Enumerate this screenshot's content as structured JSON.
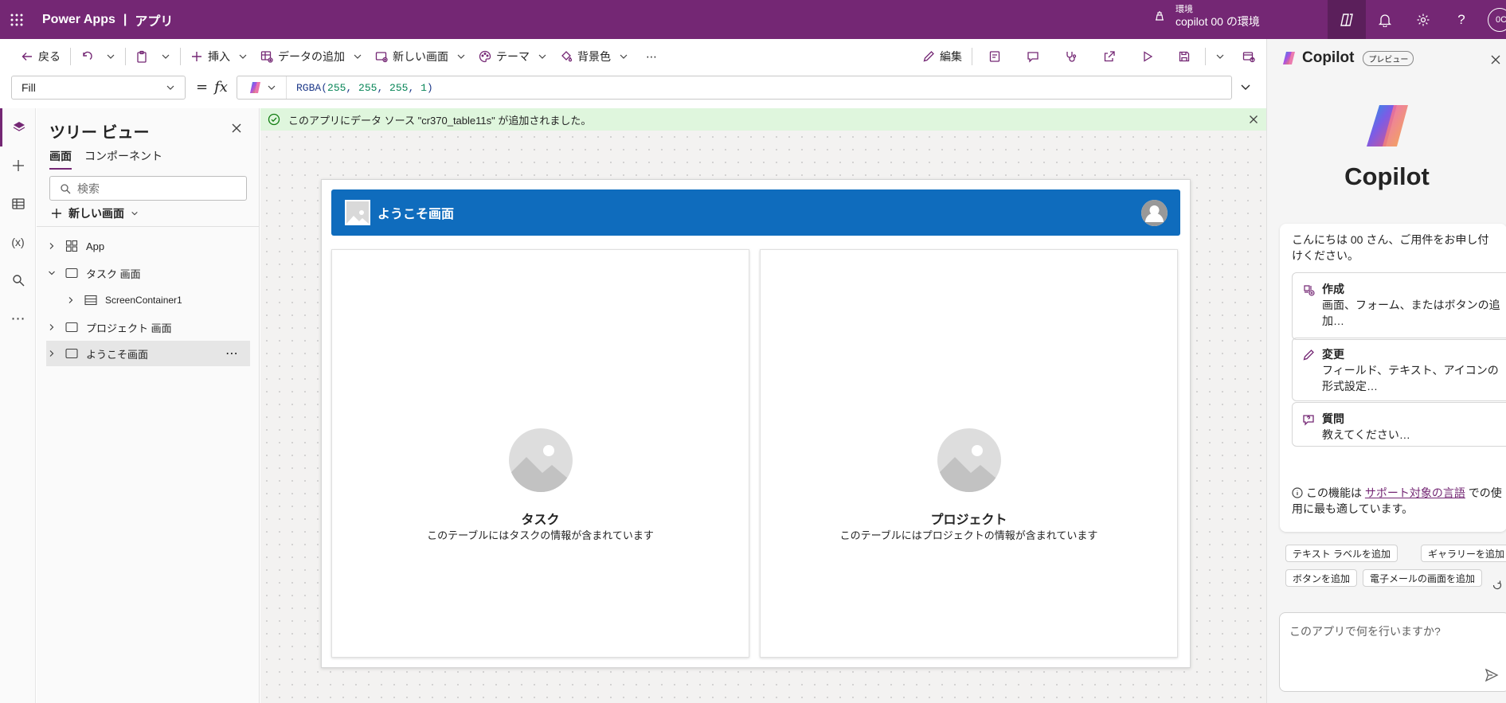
{
  "topbar": {
    "app_name": "Power Apps",
    "separator": "|",
    "section": "アプリ",
    "env_label": "環境",
    "env_name": "copilot 00 の環境",
    "avatar_initials": "0C",
    "bg_color": "#742774"
  },
  "command_bar": {
    "back": "戻る",
    "insert": "挿入",
    "add_data": "データの追加",
    "new_screen": "新しい画面",
    "theme": "テーマ",
    "background": "背景色",
    "more": "⋯",
    "edit": "編集"
  },
  "formula_bar": {
    "property": "Fill",
    "equals": "=",
    "fx": "fx",
    "formula_fn": "RGBA(",
    "formula_args": [
      "255",
      "255",
      "255",
      "1"
    ],
    "formula_close": ")"
  },
  "tree_view": {
    "title": "ツリー ビュー",
    "tabs": [
      "画面",
      "コンポーネント"
    ],
    "search_placeholder": "検索",
    "new_screen": "新しい画面",
    "nodes": [
      {
        "label": "App",
        "icon": "app-icon",
        "expanded": false
      },
      {
        "label": "タスク 画面",
        "icon": "screen-icon",
        "expanded": true
      },
      {
        "label": "ScreenContainer1",
        "icon": "container-icon",
        "expanded": false
      },
      {
        "label": "プロジェクト 画面",
        "icon": "screen-icon",
        "expanded": false
      },
      {
        "label": "ようこそ画面",
        "icon": "screen-icon",
        "expanded": false,
        "selected": true
      }
    ],
    "more": "⋯"
  },
  "notification": {
    "text": "このアプリにデータ ソース \"cr370_table11s\" が追加されました。"
  },
  "app": {
    "header_title": "ようこそ画面",
    "header_color": "#0f6cbd",
    "cards": [
      {
        "title": "タスク",
        "desc": "このテーブルにはタスクの情報が含まれています"
      },
      {
        "title": "プロジェクト",
        "desc": "このテーブルにはプロジェクトの情報が含まれています"
      }
    ]
  },
  "copilot": {
    "name": "Copilot",
    "badge": "プレビュー",
    "hero_title": "Copilot",
    "greeting": "こんにちは 00 さん、ご用件をお申し付けください。",
    "suggestions": [
      {
        "title": "作成",
        "desc": "画面、フォーム、またはボタンの追加…"
      },
      {
        "title": "変更",
        "desc": "フィールド、テキスト、アイコンの形式設定…"
      },
      {
        "title": "質問",
        "desc": "教えてください…"
      }
    ],
    "info_prefix": "この機能は ",
    "info_link": "サポート対象の言語",
    "info_suffix": " での使用に最も適しています。",
    "chips": [
      "テキスト ラベルを追加",
      "ギャラリーを追加",
      "ボタンを追加",
      "電子メールの画面を追加"
    ],
    "input_placeholder": "このアプリで何を行いますか?"
  }
}
